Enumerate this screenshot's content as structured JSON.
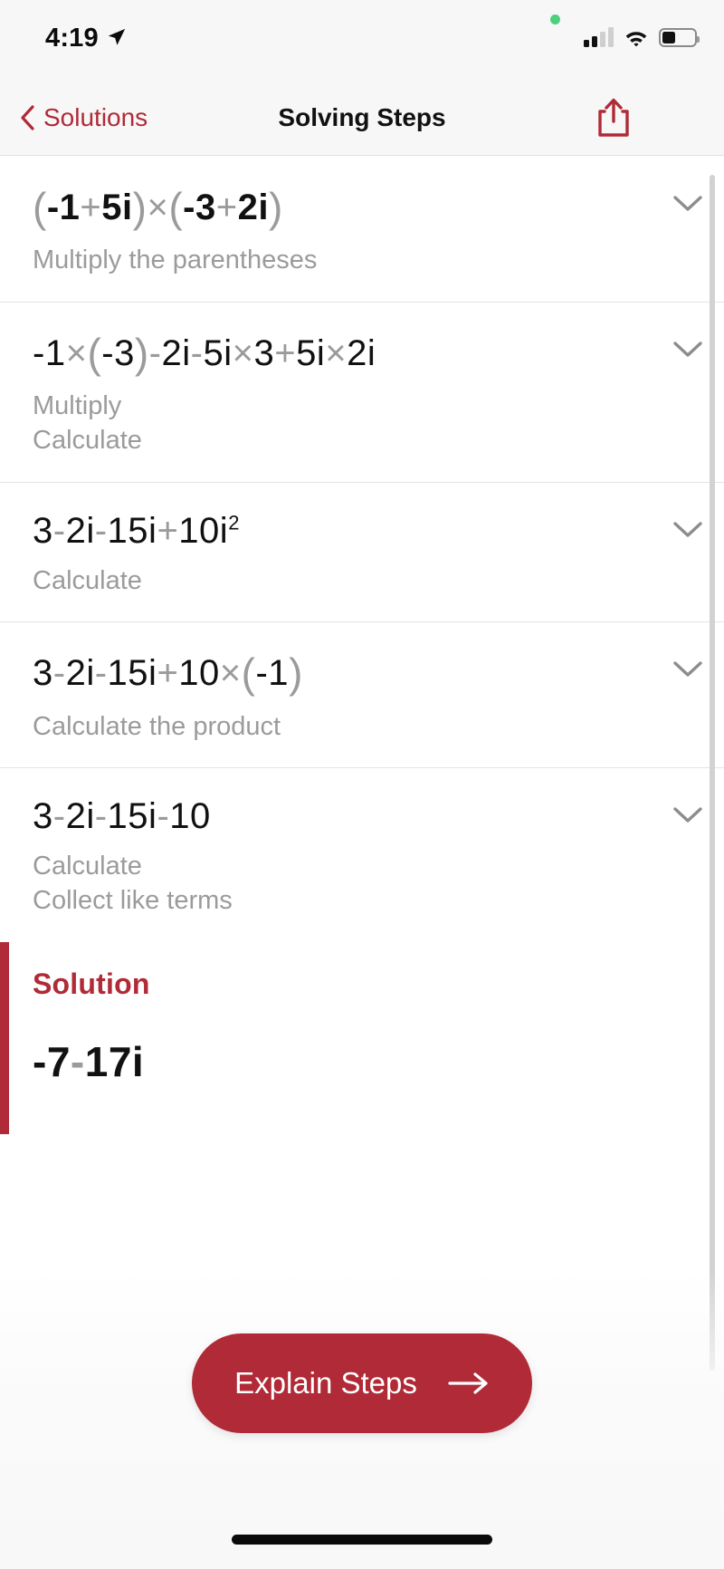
{
  "status_bar": {
    "time": "4:19",
    "location_icon": "location-arrow-icon",
    "recording_indicator": "green-recording-dot",
    "signal_icon": "cellular-signal-icon",
    "signal_bars_filled": 2,
    "signal_bars_total": 4,
    "wifi_icon": "wifi-icon",
    "battery_icon": "battery-icon",
    "battery_level_percent": 42
  },
  "nav": {
    "back_label": "Solutions",
    "back_icon": "chevron-left-icon",
    "title": "Solving Steps",
    "share_icon": "share-icon",
    "accent_color": "#b02a37"
  },
  "steps": [
    {
      "expression_plain": "(-1+5i)×(-3+2i)",
      "expression_parts": [
        {
          "t": "(",
          "k": "par"
        },
        {
          "t": "-1",
          "k": "num"
        },
        {
          "t": "+",
          "k": "op"
        },
        {
          "t": "5i",
          "k": "num"
        },
        {
          "t": ")",
          "k": "par"
        },
        {
          "t": "×",
          "k": "op"
        },
        {
          "t": "(",
          "k": "par"
        },
        {
          "t": "-3",
          "k": "num"
        },
        {
          "t": "+",
          "k": "op"
        },
        {
          "t": "2i",
          "k": "num"
        },
        {
          "t": ")",
          "k": "par"
        }
      ],
      "bold": true,
      "hints": [
        "Multiply the parentheses"
      ],
      "expand_icon": "chevron-down-icon"
    },
    {
      "expression_plain": "-1×(-3)-2i-5i×3+5i×2i",
      "expression_parts": [
        {
          "t": "-1",
          "k": "num"
        },
        {
          "t": "×",
          "k": "op"
        },
        {
          "t": "(",
          "k": "par"
        },
        {
          "t": "-3",
          "k": "num"
        },
        {
          "t": ")",
          "k": "par"
        },
        {
          "t": "-",
          "k": "op"
        },
        {
          "t": "2i",
          "k": "num"
        },
        {
          "t": "-",
          "k": "op"
        },
        {
          "t": "5i",
          "k": "num"
        },
        {
          "t": "×",
          "k": "op"
        },
        {
          "t": "3",
          "k": "num"
        },
        {
          "t": "+",
          "k": "op"
        },
        {
          "t": "5i",
          "k": "num"
        },
        {
          "t": "×",
          "k": "op"
        },
        {
          "t": "2i",
          "k": "num"
        }
      ],
      "bold": false,
      "hints": [
        "Multiply",
        "Calculate"
      ],
      "expand_icon": "chevron-down-icon"
    },
    {
      "expression_plain": "3-2i-15i+10i²",
      "expression_parts": [
        {
          "t": "3",
          "k": "num"
        },
        {
          "t": "-",
          "k": "op"
        },
        {
          "t": "2i",
          "k": "num"
        },
        {
          "t": "-",
          "k": "op"
        },
        {
          "t": "15i",
          "k": "num"
        },
        {
          "t": "+",
          "k": "op"
        },
        {
          "t": "10i",
          "k": "num",
          "sup": "2"
        }
      ],
      "bold": false,
      "hints": [
        "Calculate"
      ],
      "expand_icon": "chevron-down-icon"
    },
    {
      "expression_plain": "3-2i-15i+10×(-1)",
      "expression_parts": [
        {
          "t": "3",
          "k": "num"
        },
        {
          "t": "-",
          "k": "op"
        },
        {
          "t": "2i",
          "k": "num"
        },
        {
          "t": "-",
          "k": "op"
        },
        {
          "t": "15i",
          "k": "num"
        },
        {
          "t": "+",
          "k": "op"
        },
        {
          "t": "10",
          "k": "num"
        },
        {
          "t": "×",
          "k": "op"
        },
        {
          "t": "(",
          "k": "par"
        },
        {
          "t": "-1",
          "k": "num"
        },
        {
          "t": ")",
          "k": "par"
        }
      ],
      "bold": false,
      "hints": [
        "Calculate the product"
      ],
      "expand_icon": "chevron-down-icon"
    },
    {
      "expression_plain": "3-2i-15i-10",
      "expression_parts": [
        {
          "t": "3",
          "k": "num"
        },
        {
          "t": "-",
          "k": "op"
        },
        {
          "t": "2i",
          "k": "num"
        },
        {
          "t": "-",
          "k": "op"
        },
        {
          "t": "15i",
          "k": "num"
        },
        {
          "t": "-",
          "k": "op"
        },
        {
          "t": "10",
          "k": "num"
        }
      ],
      "bold": false,
      "hints": [
        "Calculate",
        "Collect like terms"
      ],
      "expand_icon": "chevron-down-icon"
    }
  ],
  "solution": {
    "title": "Solution",
    "value_plain": "-7-17i",
    "value_parts": [
      {
        "t": "-7",
        "k": "num"
      },
      {
        "t": "-",
        "k": "op"
      },
      {
        "t": "17i",
        "k": "num"
      }
    ],
    "accent_color": "#b02a37"
  },
  "cta": {
    "label": "Explain Steps",
    "arrow_icon": "arrow-right-icon",
    "background_color": "#b02a37"
  },
  "home_indicator": "home-indicator-bar"
}
